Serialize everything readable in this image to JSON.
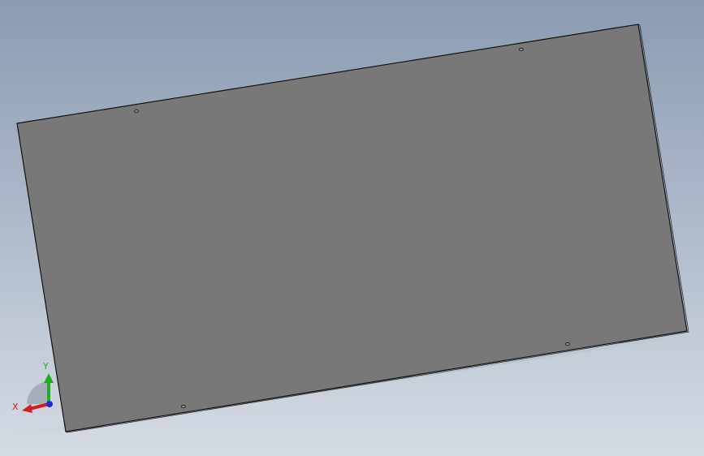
{
  "viewport": {
    "background": {
      "top_color": "#8a9bb2",
      "bottom_color": "#d5dbe3"
    }
  },
  "model": {
    "name": "sheet-metal-panel",
    "face_color": "#787878",
    "edge_color": "#111111",
    "hole_count": 4
  },
  "triad": {
    "x_label": "X",
    "y_label": "Y",
    "x_color": "#d61d1d",
    "y_color": "#1fae1f",
    "z_color": "#1e2bd6"
  }
}
